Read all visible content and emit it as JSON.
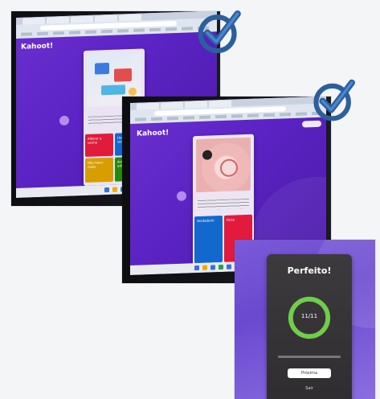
{
  "photo1": {
    "app_logo": "Kahoot!",
    "answers": [
      {
        "text": "Alterar a senha",
        "color": "#e21b3c"
      },
      {
        "text": "Usar a mesma senha",
        "color": "#1368ce"
      },
      {
        "text": "Não fazer nada",
        "color": "#d89e00"
      },
      {
        "text": "Avisar um adulto",
        "color": "#26890c"
      }
    ]
  },
  "photo2": {
    "app_logo": "Kahoot!",
    "answers": [
      {
        "text": "Verdadeiro",
        "color": "#1368ce"
      },
      {
        "text": "Falso",
        "color": "#e21b3c"
      }
    ]
  },
  "photo3": {
    "title": "Perfeito!",
    "score": "11/11",
    "primary_button": "Próxima",
    "secondary_button": "Sair"
  },
  "colors": {
    "check": "#2c5f9e",
    "kahoot_purple": "#5b23c4"
  },
  "icons": [
    "check-circle-icon",
    "check-circle-icon"
  ]
}
